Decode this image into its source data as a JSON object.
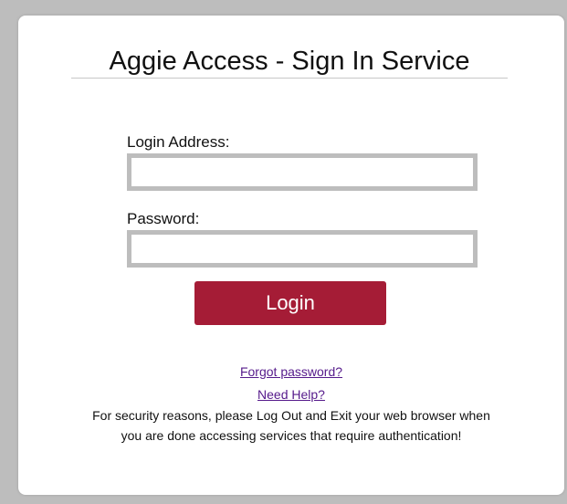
{
  "page": {
    "title": "Aggie Access - Sign In Service"
  },
  "form": {
    "login_label": "Login Address:",
    "login_value": "",
    "password_label": "Password:",
    "password_value": "",
    "login_button": "Login"
  },
  "links": {
    "forgot_password": "Forgot password?",
    "need_help": "Need Help?"
  },
  "notice": {
    "line1": "For security reasons, please Log Out and Exit your web browser when",
    "line2": "you are done accessing services that require authentication!"
  },
  "colors": {
    "accent": "#a51c36",
    "link": "#551a8b",
    "field_border": "#bdbdbd",
    "background": "#bdbdbd"
  }
}
